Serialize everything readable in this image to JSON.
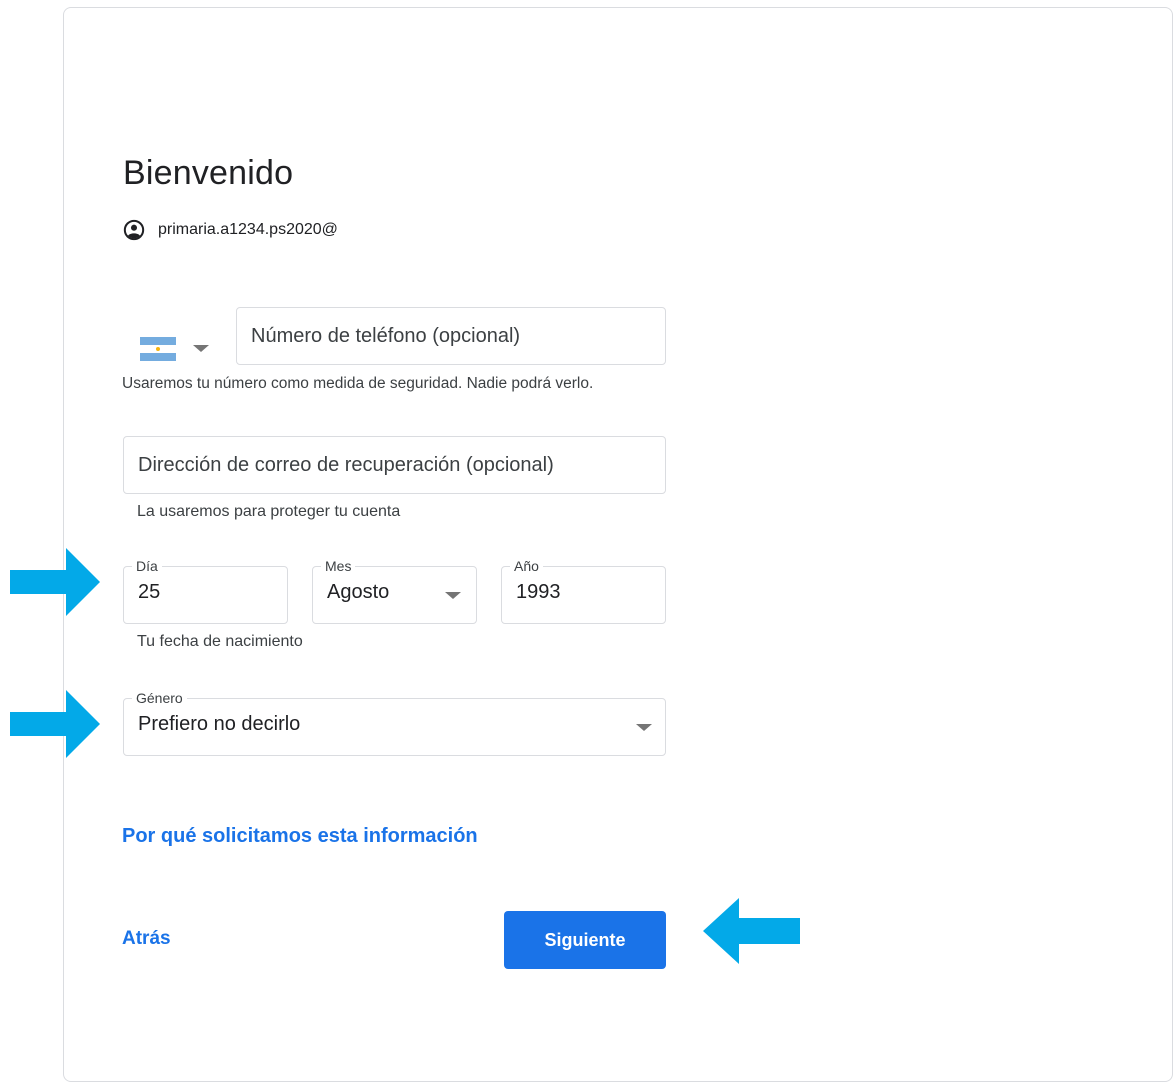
{
  "header": {
    "title": "Bienvenido",
    "account_email": "primaria.a1234.ps2020@"
  },
  "phone": {
    "country_flag": "argentina-flag-icon",
    "placeholder": "Número de teléfono (opcional)",
    "hint": "Usaremos tu número como medida de seguridad. Nadie podrá verlo."
  },
  "recovery": {
    "placeholder": "Dirección de correo de recuperación (opcional)",
    "hint": "La usaremos para proteger tu cuenta"
  },
  "birthday": {
    "day_label": "Día",
    "day_value": "25",
    "month_label": "Mes",
    "month_value": "Agosto",
    "year_label": "Año",
    "year_value": "1993",
    "hint": "Tu fecha de nacimiento"
  },
  "gender": {
    "label": "Género",
    "value": "Prefiero no decirlo"
  },
  "links": {
    "why": "Por qué solicitamos esta información",
    "back": "Atrás"
  },
  "actions": {
    "next": "Siguiente"
  },
  "colors": {
    "accent": "#1a73e8",
    "annotation_arrow": "#03a9e8",
    "border": "#dadce0"
  }
}
